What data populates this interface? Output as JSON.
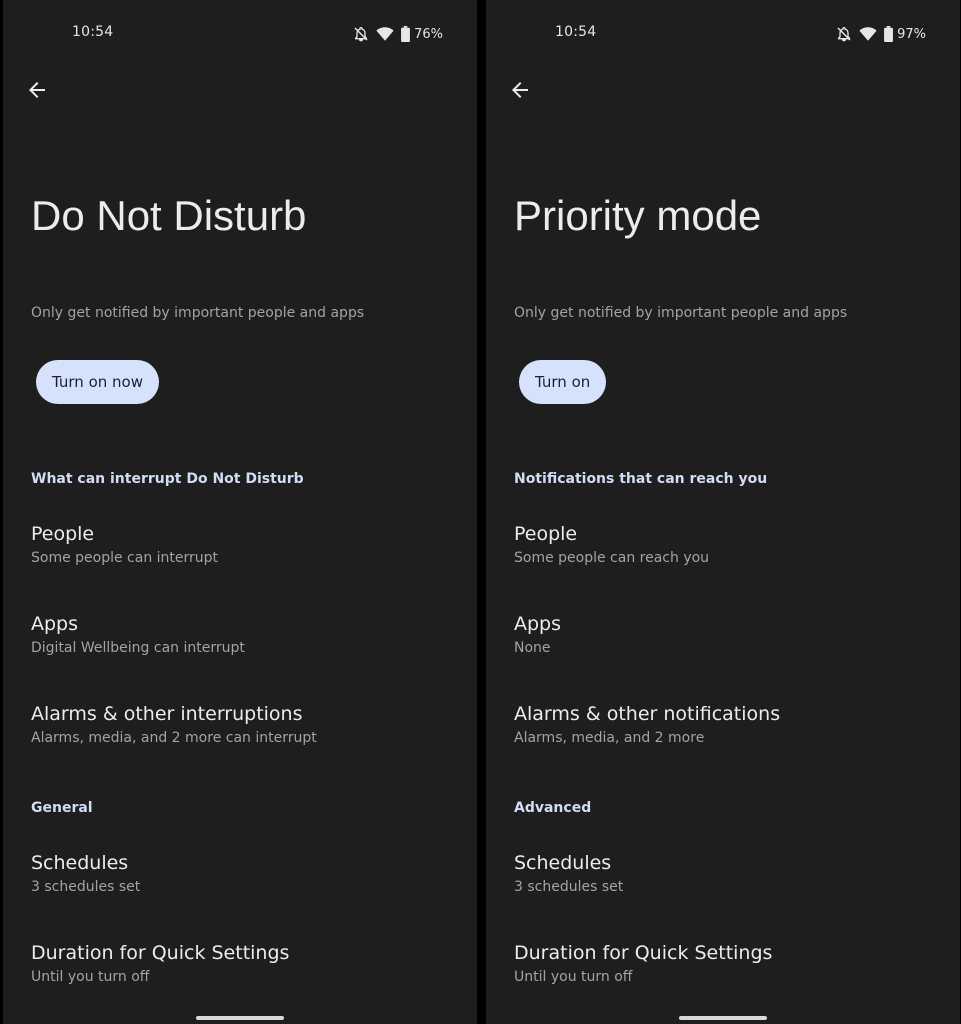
{
  "icons": {
    "back": "arrow-left-icon",
    "notifications_off": "bell-off-icon",
    "wifi": "wifi-icon",
    "battery": "battery-icon"
  },
  "colors": {
    "background": "#1e1e1e",
    "primary_text": "#ececec",
    "secondary_text": "#a3a3a3",
    "section_header": "#d2dcf5",
    "button_bg": "#d6e2fb",
    "button_text": "#1b2134"
  },
  "left": {
    "status": {
      "time": "10:54",
      "battery": "76%"
    },
    "title": "Do Not Disturb",
    "description": "Only get notified by important people and apps",
    "action_button": "Turn on now",
    "section1_header": "What can interrupt Do Not Disturb",
    "people": {
      "title": "People",
      "subtitle": "Some people can interrupt"
    },
    "apps": {
      "title": "Apps",
      "subtitle": "Digital Wellbeing can interrupt"
    },
    "alarms": {
      "title": "Alarms & other interruptions",
      "subtitle": "Alarms, media, and 2 more can interrupt"
    },
    "section2_header": "General",
    "schedules": {
      "title": "Schedules",
      "subtitle": "3 schedules set"
    },
    "duration": {
      "title": "Duration for Quick Settings",
      "subtitle": "Until you turn off"
    }
  },
  "right": {
    "status": {
      "time": "10:54",
      "battery": "97%"
    },
    "title": "Priority mode",
    "description": "Only get notified by important people and apps",
    "action_button": "Turn on",
    "section1_header": "Notifications that can reach you",
    "people": {
      "title": "People",
      "subtitle": "Some people can reach you"
    },
    "apps": {
      "title": "Apps",
      "subtitle": "None"
    },
    "alarms": {
      "title": "Alarms & other notifications",
      "subtitle": "Alarms, media, and 2 more"
    },
    "section2_header": "Advanced",
    "schedules": {
      "title": "Schedules",
      "subtitle": "3 schedules set"
    },
    "duration": {
      "title": "Duration for Quick Settings",
      "subtitle": "Until you turn off"
    }
  }
}
